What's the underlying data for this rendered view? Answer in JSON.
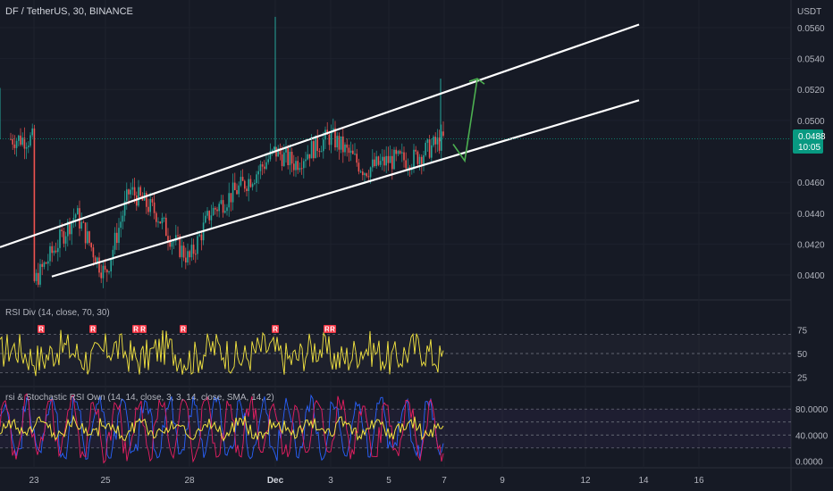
{
  "header": {
    "symbol": "DF / TetherUS, 30, BINANCE"
  },
  "price_axis": {
    "currency": "USDT",
    "ticks": [
      "0.0560",
      "0.0540",
      "0.0520",
      "0.0500",
      "0.0460",
      "0.0440",
      "0.0420",
      "0.0400"
    ],
    "current_price": "0.0488",
    "countdown": "10:05",
    "badge_color": "#089981"
  },
  "time_axis": {
    "labels": [
      "23",
      "25",
      "28",
      "Dec",
      "3",
      "5",
      "7",
      "9",
      "12",
      "14",
      "16"
    ]
  },
  "rsi_div": {
    "title": "RSI Div (14, close, 70, 30)",
    "ticks": [
      "75",
      "50",
      "25"
    ],
    "marker_label": "R",
    "marker_color": "#f23645",
    "line_color": "#f5e640"
  },
  "stoch_rsi": {
    "title": "rsi & Stochastic RSI Own (14, 14, close, 3, 3, 14, close, SMA, 14, 2)",
    "ticks": [
      "80.0000",
      "40.0000",
      "0.0000"
    ]
  },
  "chart_data": {
    "type": "candlestick",
    "title": "DF / TetherUS, 30, BINANCE",
    "ylabel": "USDT",
    "ylim": [
      0.0385,
      0.0575
    ],
    "x_labels": [
      "23",
      "25",
      "28",
      "Dec",
      "3",
      "5",
      "7",
      "9",
      "12",
      "14",
      "16"
    ],
    "last_close": 0.0488,
    "swing_points": [
      {
        "x": "23",
        "y": 0.0395
      },
      {
        "x": "24",
        "y": 0.044
      },
      {
        "x": "24.5",
        "y": 0.0408
      },
      {
        "x": "25",
        "y": 0.04
      },
      {
        "x": "25.5",
        "y": 0.0455
      },
      {
        "x": "26.5",
        "y": 0.044
      },
      {
        "x": "27",
        "y": 0.0425
      },
      {
        "x": "28",
        "y": 0.041
      },
      {
        "x": "28.5",
        "y": 0.044
      },
      {
        "x": "29",
        "y": 0.045
      },
      {
        "x": "30",
        "y": 0.0465
      },
      {
        "x": "Dec",
        "y": 0.048
      },
      {
        "x": "Dec 1.2",
        "y": 0.0472
      },
      {
        "x": "2",
        "y": 0.048
      },
      {
        "x": "3",
        "y": 0.049
      },
      {
        "x": "4",
        "y": 0.0468
      },
      {
        "x": "5",
        "y": 0.0474
      },
      {
        "x": "6",
        "y": 0.0475
      },
      {
        "x": "7",
        "y": 0.0488
      }
    ],
    "wicks_high": [
      {
        "x": "24.6",
        "y": 0.0521
      },
      {
        "x": "Dec",
        "y": 0.0567
      },
      {
        "x": "6.8",
        "y": 0.0527
      }
    ],
    "channel": {
      "upper": [
        {
          "x": "21.5",
          "y": 0.0418
        },
        {
          "x": "14",
          "y": 0.0562
        }
      ],
      "lower": [
        {
          "x": "22.5",
          "y": 0.0399
        },
        {
          "x": "14",
          "y": 0.0513
        }
      ]
    },
    "projection_arrow": {
      "from": {
        "x": "7.5",
        "y": 0.0475
      },
      "via": {
        "x": "7.2",
        "y": 0.048
      },
      "to": {
        "x": "8",
        "y": 0.0527
      }
    },
    "rsi": {
      "levels": [
        70,
        50,
        30
      ],
      "ylim": [
        20,
        95
      ]
    },
    "stoch": {
      "levels": [
        80,
        60,
        40,
        20
      ],
      "ylim": [
        -5,
        105
      ]
    }
  }
}
